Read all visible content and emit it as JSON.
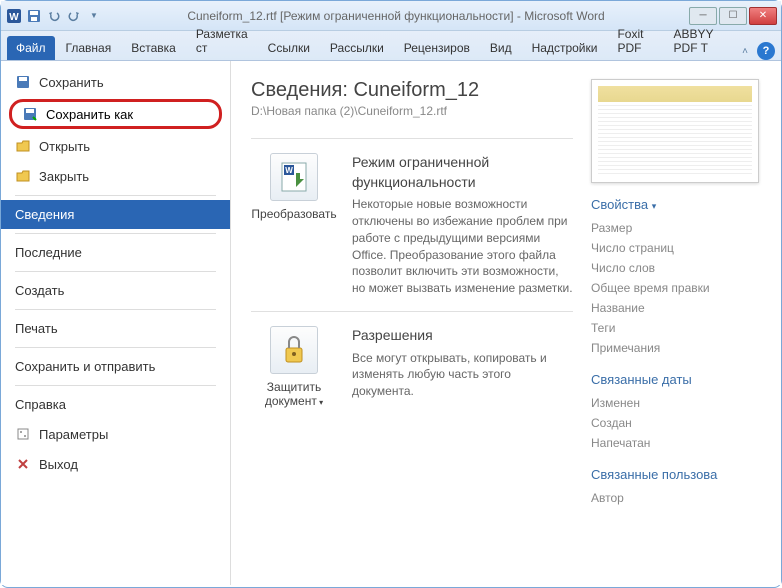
{
  "titlebar": {
    "title": "Cuneiform_12.rtf [Режим ограниченной функциональности] - Microsoft Word"
  },
  "tabs": {
    "file": "Файл",
    "home": "Главная",
    "insert": "Вставка",
    "layout": "Разметка ст",
    "refs": "Ссылки",
    "mail": "Рассылки",
    "review": "Рецензиров",
    "view": "Вид",
    "addins": "Надстройки",
    "foxit": "Foxit PDF",
    "abbyy": "ABBYY PDF T"
  },
  "sidebar": {
    "save": "Сохранить",
    "saveas": "Сохранить как",
    "open": "Открыть",
    "close": "Закрыть",
    "info": "Сведения",
    "recent": "Последние",
    "new": "Создать",
    "print": "Печать",
    "share": "Сохранить и отправить",
    "help": "Справка",
    "options": "Параметры",
    "exit": "Выход"
  },
  "content": {
    "heading_prefix": "Сведения: ",
    "heading_doc": "Cuneiform_12",
    "path": "D:\\Новая папка (2)\\Cuneiform_12.rtf",
    "compat": {
      "btn": "Преобразовать",
      "title": "Режим ограниченной функциональности",
      "body": "Некоторые новые возможности отключены во избежание проблем при работе с предыдущими версиями Office. Преобразование этого файла позволит включить эти возможности, но может вызвать изменение разметки."
    },
    "perm": {
      "btn": "Защитить документ",
      "title": "Разрешения",
      "body": "Все могут открывать, копировать и изменять любую часть этого документа."
    }
  },
  "rightpane": {
    "props_head": "Свойства",
    "size": "Размер",
    "pages": "Число страниц",
    "words": "Число слов",
    "edit_time": "Общее время правки",
    "title": "Название",
    "tags": "Теги",
    "comments": "Примечания",
    "dates_head": "Связанные даты",
    "modified": "Изменен",
    "created": "Создан",
    "printed": "Напечатан",
    "people_head": "Связанные пользова",
    "author": "Автор"
  }
}
